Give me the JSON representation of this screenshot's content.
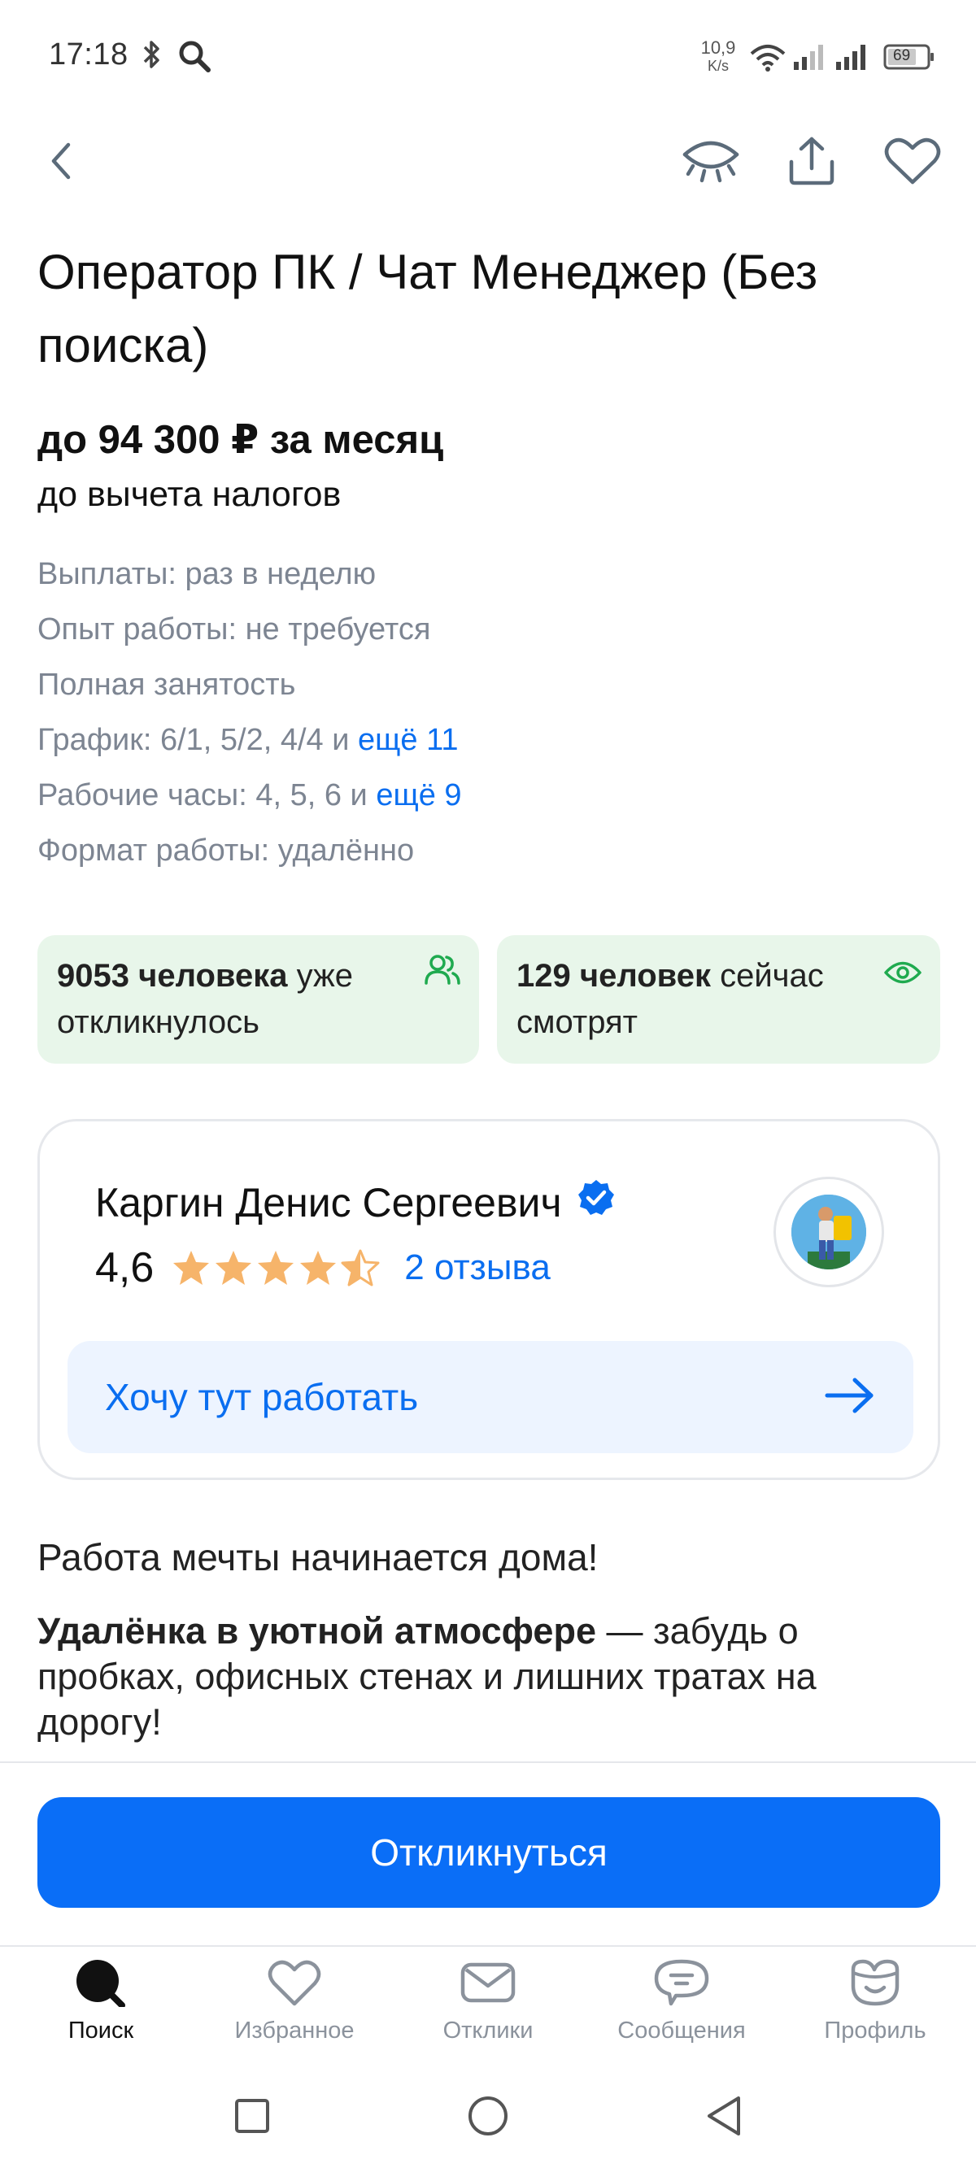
{
  "status_bar": {
    "time": "17:18",
    "net_speed_value": "10,9",
    "net_speed_unit": "K/s",
    "battery": "69",
    "icons": [
      "bluetooth-icon",
      "search-icon",
      "wifi-icon",
      "signal-icon",
      "signal-icon",
      "battery-icon"
    ]
  },
  "header": {
    "back_icon": "chevron-left-icon",
    "hide_icon": "eye-closed-icon",
    "share_icon": "share-icon",
    "favorite_icon": "heart-icon"
  },
  "vacancy": {
    "title": "Оператор ПК / Чат Менеджер (Без поиска)",
    "salary": "до 94 300 ₽ за месяц",
    "salary_note": "до вычета налогов",
    "details": [
      {
        "text": "Выплаты: раз в неделю",
        "more": ""
      },
      {
        "text": "Опыт работы: не требуется",
        "more": ""
      },
      {
        "text": "Полная занятость",
        "more": ""
      },
      {
        "text": "График: 6/1, 5/2, 4/4 и ",
        "more": "ещё 11"
      },
      {
        "text": "Рабочие часы: 4, 5, 6 и ",
        "more": "ещё 9"
      },
      {
        "text": "Формат работы: удалённо",
        "more": ""
      }
    ]
  },
  "stats": {
    "responded_count": "9053 человека",
    "responded_rest_1": " уже",
    "responded_rest_2": "откликнулось",
    "watching_count": "129 человек",
    "watching_rest_1": " сейчас",
    "watching_rest_2": "смотрят",
    "colors": {
      "card_bg": "#e8f6ea",
      "icon": "#1faa4f"
    }
  },
  "employer": {
    "name": "Каргин Денис Сергеевич",
    "rating": "4,6",
    "stars": 4.6,
    "reviews_link": "2 отзыва",
    "cta": "Хочу тут работать"
  },
  "description": {
    "heading": "Работа мечты начинается дома!",
    "bold_lead": "Удалёнка в уютной атмосфере",
    "text": " — забудь о пробках, офисных стенах и лишних тратах на дорогу!"
  },
  "apply_button": "Откликнуться",
  "tabs": [
    {
      "label": "Поиск",
      "icon": "search-icon",
      "active": true
    },
    {
      "label": "Избранное",
      "icon": "heart-icon",
      "active": false
    },
    {
      "label": "Отклики",
      "icon": "mail-icon",
      "active": false
    },
    {
      "label": "Сообщения",
      "icon": "chat-icon",
      "active": false
    },
    {
      "label": "Профиль",
      "icon": "profile-icon",
      "active": false
    }
  ],
  "colors": {
    "accent": "#0a6ef7",
    "link": "#0a6ef0",
    "muted_text": "#7d8592",
    "star": "#f6b46a"
  }
}
